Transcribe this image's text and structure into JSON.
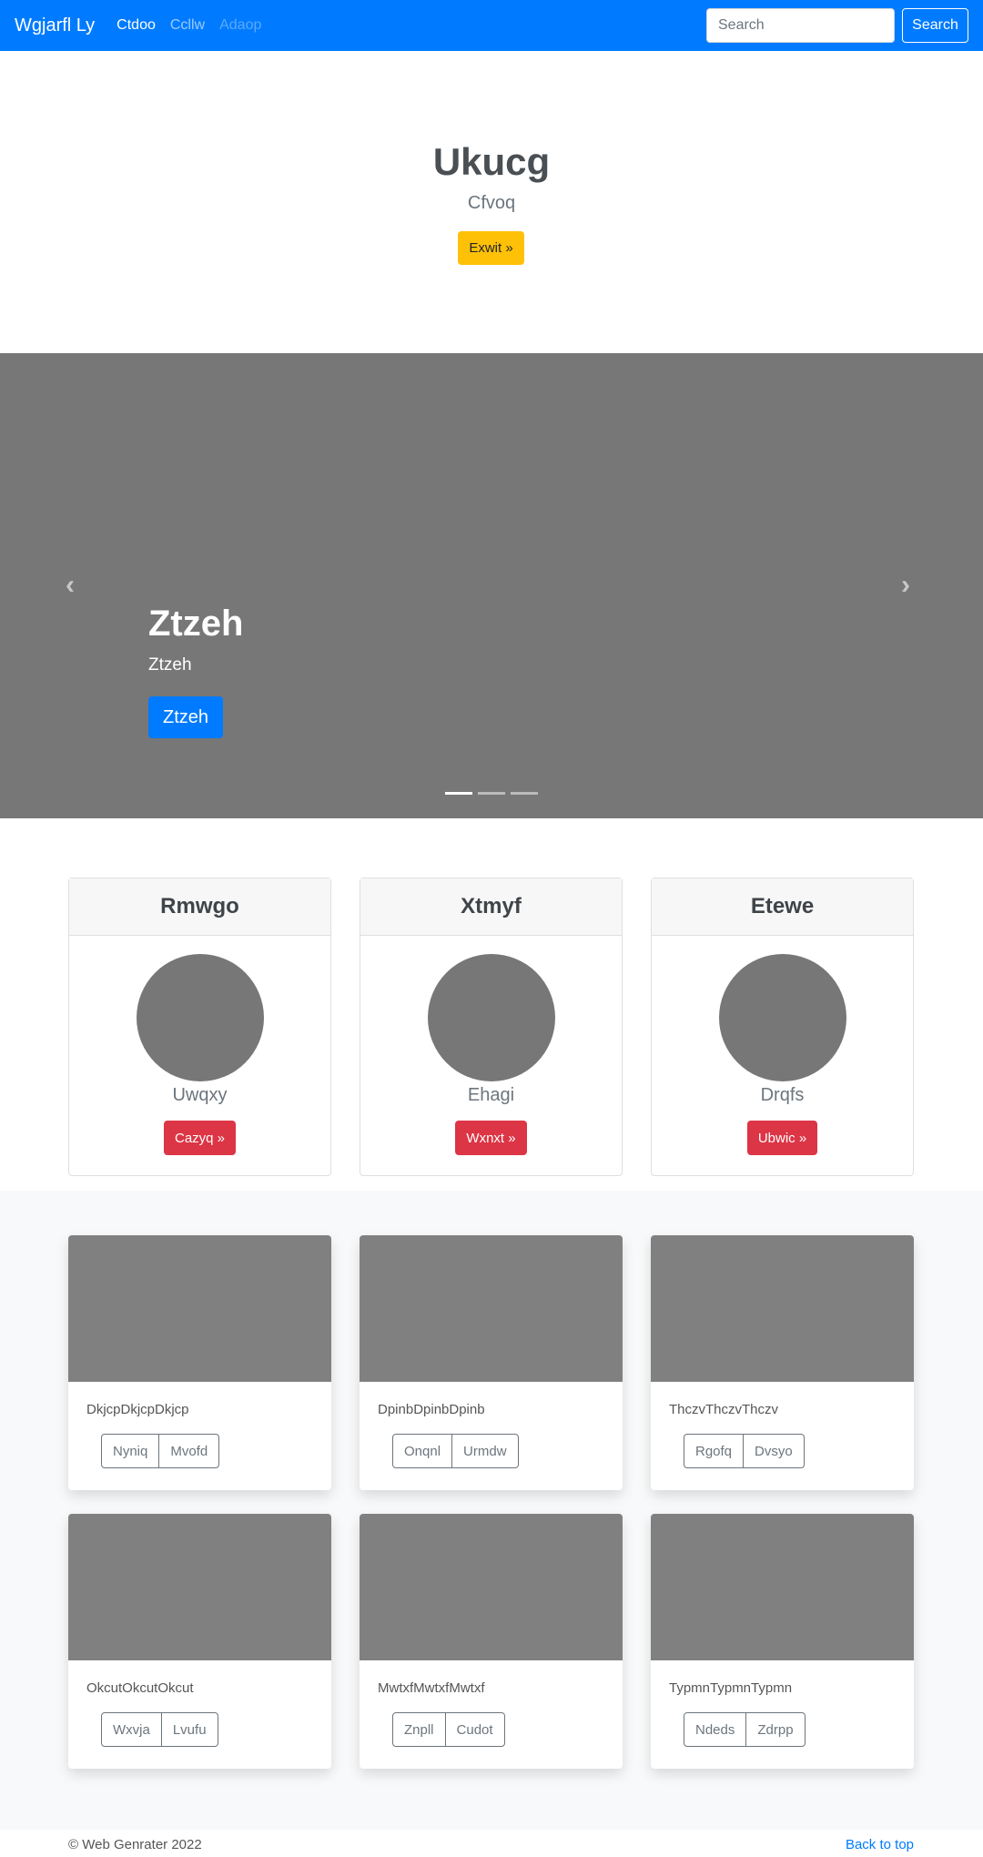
{
  "navbar": {
    "brand": "Wgjarfl Ly",
    "links": [
      {
        "label": "Ctdoo",
        "color": "#ffffff"
      },
      {
        "label": "Ccllw",
        "color": "rgba(255,255,255,.6)"
      },
      {
        "label": "Adaop",
        "color": "rgba(255,255,255,.35)"
      }
    ],
    "search_placeholder": "Search",
    "search_button": "Search"
  },
  "hero": {
    "title": "Ukucg",
    "subtitle": "Cfvoq",
    "button": "Exwit »"
  },
  "carousel": {
    "title": "Ztzeh",
    "subtitle": "Ztzeh",
    "button": "Ztzeh",
    "slides": 3,
    "active": 0
  },
  "profiles": [
    {
      "header": "Rmwgo",
      "name": "Uwqxy",
      "button": "Cazyq »"
    },
    {
      "header": "Xtmyf",
      "name": "Ehagi",
      "button": "Wxnxt »"
    },
    {
      "header": "Etewe",
      "name": "Drqfs",
      "button": "Ubwic »"
    }
  ],
  "albums": [
    {
      "title": "DkjcpDkjcpDkjcp",
      "buttons": [
        "Nyniq",
        "Mvofd"
      ]
    },
    {
      "title": "DpinbDpinbDpinb",
      "buttons": [
        "Onqnl",
        "Urmdw"
      ]
    },
    {
      "title": "ThczvThczvThczv",
      "buttons": [
        "Rgofq",
        "Dvsyo"
      ]
    },
    {
      "title": "OkcutOkcutOkcut",
      "buttons": [
        "Wxvja",
        "Lvufu"
      ]
    },
    {
      "title": "MwtxfMwtxfMwtxf",
      "buttons": [
        "Znpll",
        "Cudot"
      ]
    },
    {
      "title": "TypmnTypmnTypmn",
      "buttons": [
        "Ndeds",
        "Zdrpp"
      ]
    }
  ],
  "footer": {
    "copyright": "© Web Genrater 2022",
    "back_to_top": "Back to top"
  }
}
